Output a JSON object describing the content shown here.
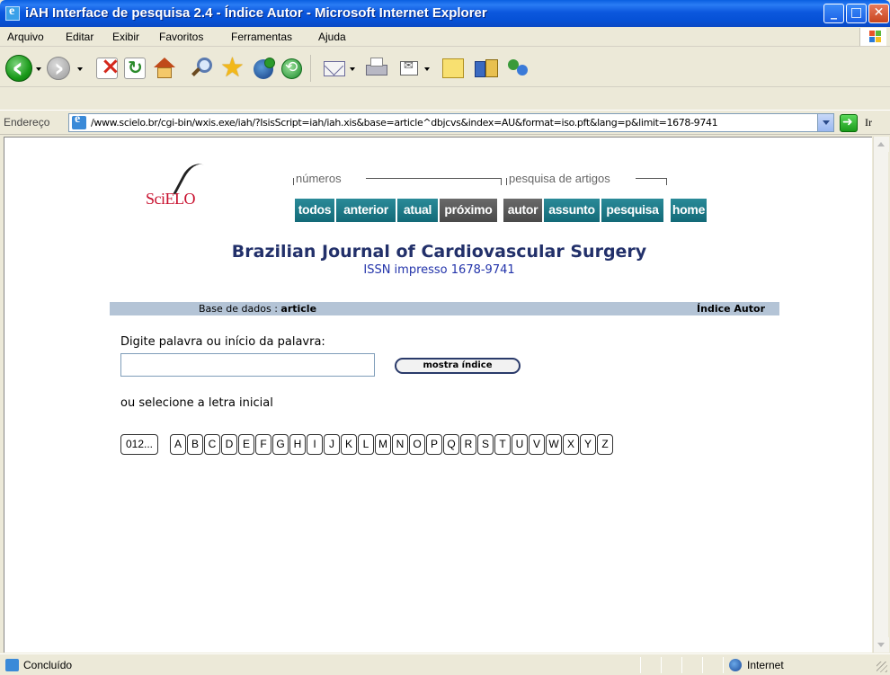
{
  "window": {
    "title": "iAH Interface de pesquisa 2.4 - Índice Autor - Microsoft Internet Explorer",
    "minimize": "_",
    "maximize": "□",
    "close": "✕"
  },
  "menu": [
    "Arquivo",
    "Editar",
    "Exibir",
    "Favoritos",
    "Ferramentas",
    "Ajuda"
  ],
  "toolbar": {
    "icons": [
      "back-icon",
      "forward-icon",
      "stop-icon",
      "refresh-icon",
      "home-icon",
      "search-icon",
      "favorites-icon",
      "media-icon",
      "history-icon",
      "mail-icon",
      "print-icon",
      "edit-icon",
      "notes-icon",
      "research-icon",
      "messenger-icon"
    ]
  },
  "address": {
    "label": "Endereço",
    "url": "/www.scielo.br/cgi-bin/wxis.exe/iah/?IsisScript=iah/iah.xis&base=article^dbjcvs&index=AU&format=iso.pft&lang=p&limit=1678-9741",
    "go": "Ir"
  },
  "page": {
    "logo": "SciELO",
    "groups": {
      "numeros": "números",
      "pesquisa": "pesquisa de artigos"
    },
    "nav": {
      "todos": "todos",
      "anterior": "anterior",
      "atual": "atual",
      "proximo": "próximo",
      "autor": "autor",
      "assunto": "assunto",
      "pesquisa": "pesquisa",
      "home": "home"
    },
    "journal_title": "Brazilian Journal of Cardiovascular Surgery",
    "issn": "ISSN impresso 1678-9741",
    "db_label": "Base de dados : ",
    "db_name": "article",
    "index_name": "Índice Autor",
    "prompt": "Digite palavra ou início da palavra:",
    "word_value": "",
    "show_index_button": "mostra índice",
    "or_select": "ou selecione a letra inicial",
    "letters": [
      "012...",
      "A",
      "B",
      "C",
      "D",
      "E",
      "F",
      "G",
      "H",
      "I",
      "J",
      "K",
      "L",
      "M",
      "N",
      "O",
      "P",
      "Q",
      "R",
      "S",
      "T",
      "U",
      "V",
      "W",
      "X",
      "Y",
      "Z"
    ]
  },
  "status": {
    "text": "Concluído",
    "zone": "Internet"
  }
}
